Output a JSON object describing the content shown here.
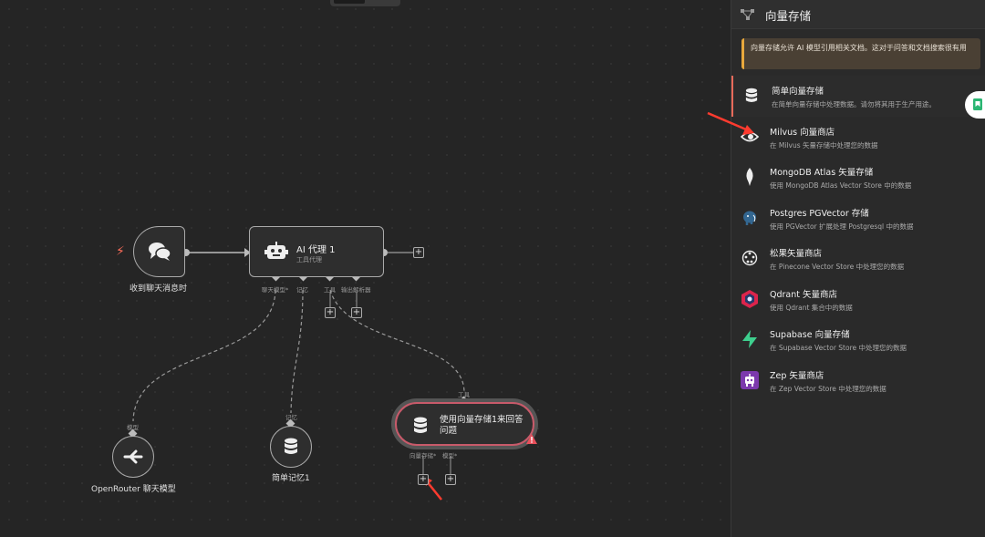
{
  "canvas": {
    "trigger_label": "收到聊天消息时",
    "agent_title": "AI 代理 1",
    "agent_subtitle": "工具代理",
    "agent_ports": [
      "聊天模型*",
      "记忆",
      "工具",
      "输出解析器"
    ],
    "openrouter_label": "OpenRouter 聊天模型",
    "openrouter_port": "模型",
    "memory_label": "简单记忆1",
    "memory_port": "记忆",
    "vector_title": "使用向量存储1来回答问题",
    "vector_top_port": "工具",
    "vector_ports": [
      "向量存储*",
      "模型*"
    ],
    "plus_glyph": "+"
  },
  "panel": {
    "title": "向量存储",
    "notice": "向量存储允许 AI 模型引用相关文档。这对于问答和文档搜索很有用",
    "items": [
      {
        "title": "简单向量存储",
        "desc": "在简单向量存储中处理数据。请勿将其用于生产用途。",
        "icon": "database-icon"
      },
      {
        "title": "Milvus 向量商店",
        "desc": "在 Milvus 矢量存储中处理您的数据",
        "icon": "milvus-icon"
      },
      {
        "title": "MongoDB Atlas 矢量存储",
        "desc": "使用 MongoDB Atlas Vector Store 中的数据",
        "icon": "mongodb-leaf-icon"
      },
      {
        "title": "Postgres PGVector 存储",
        "desc": "使用 PGVector 扩展处理 Postgresql 中的数据",
        "icon": "postgres-elephant-icon"
      },
      {
        "title": "松果矢量商店",
        "desc": "在 Pinecone Vector Store 中处理您的数据",
        "icon": "pinecone-icon"
      },
      {
        "title": "Qdrant 矢量商店",
        "desc": "使用 Qdrant 集合中的数据",
        "icon": "qdrant-icon"
      },
      {
        "title": "Supabase 向量存储",
        "desc": "在 Supabase Vector Store 中处理您的数据",
        "icon": "supabase-bolt-icon"
      },
      {
        "title": "Zep 矢量商店",
        "desc": "在 Zep Vector Store 中处理您的数据",
        "icon": "zep-robot-icon"
      }
    ]
  },
  "colors": {
    "accent": "#e86a5a",
    "arrow": "#ff3b2f",
    "warning": "#e8a83c"
  }
}
